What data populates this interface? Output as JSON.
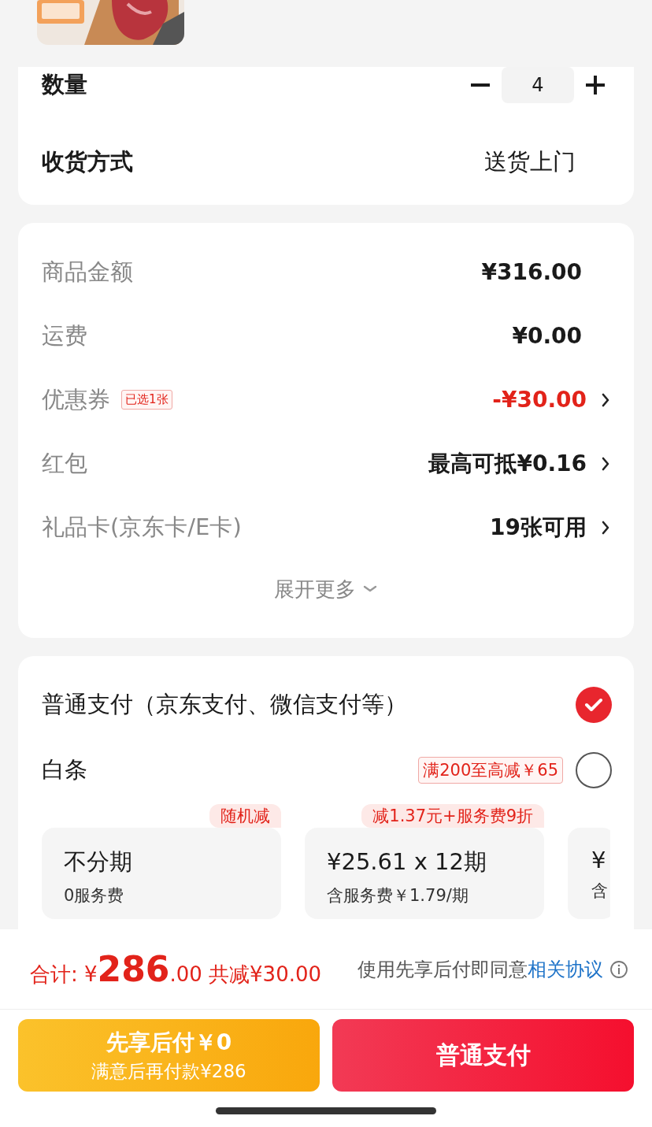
{
  "quantity": {
    "label": "数量",
    "value": "4"
  },
  "delivery": {
    "label": "收货方式",
    "value": "送货上门"
  },
  "summary": {
    "rows": [
      {
        "label": "商品金额",
        "value": "¥316.00",
        "kind": "plain"
      },
      {
        "label": "运费",
        "value": "¥0.00",
        "kind": "plain"
      },
      {
        "label": "优惠券",
        "badge": "已选1张",
        "value": "-¥30.00",
        "kind": "discount"
      },
      {
        "label": "红包",
        "value": "最高可抵¥0.16",
        "kind": "link"
      },
      {
        "label": "礼品卡(京东卡/E卡)",
        "value": "19张可用",
        "kind": "link"
      }
    ],
    "expand": "展开更多"
  },
  "payment": {
    "options": [
      {
        "label": "普通支付（京东支付、微信支付等）",
        "selected": true
      },
      {
        "label": "白条",
        "promo": "满200至高减￥65",
        "selected": false
      }
    ],
    "plans": [
      {
        "tag": "随机减",
        "title": "不分期",
        "subtitle": "0服务费"
      },
      {
        "tag": "减1.37元+服务费9折",
        "title": "¥25.61 x 12期",
        "subtitle": "含服务费￥1.79/期"
      },
      {
        "title": "¥",
        "subtitle": "含"
      }
    ]
  },
  "footer": {
    "total_label": "合计:",
    "currency": "¥",
    "amount": "286",
    "decimals": ".00",
    "saved": "共减¥30.00",
    "agreement": "使用先享后付即同意",
    "agreement_link": "相关协议"
  },
  "buttons": {
    "pay_later": {
      "title": "先享后付￥0",
      "subtitle": "满意后再付款¥286"
    },
    "pay": "普通支付"
  }
}
